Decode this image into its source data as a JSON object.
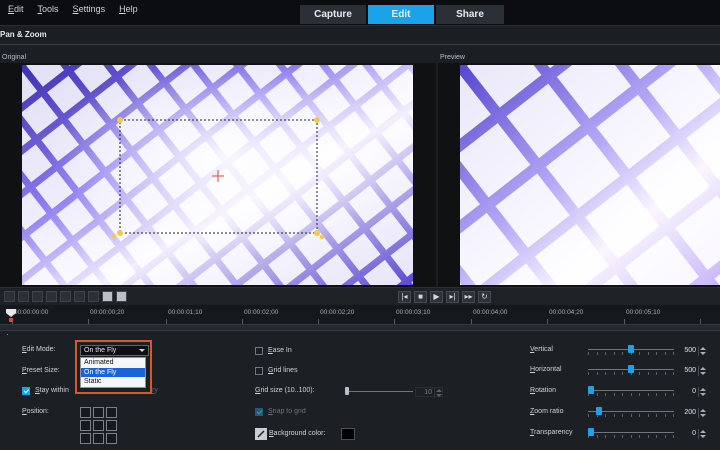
{
  "menu": [
    "Edit",
    "Tools",
    "Settings",
    "Help"
  ],
  "tabs": [
    {
      "label": "Capture",
      "active": false
    },
    {
      "label": "Edit",
      "active": true
    },
    {
      "label": "Share",
      "active": false
    }
  ],
  "panel_title": "Pan & Zoom",
  "original_label": "Original",
  "preview_label": "Preview",
  "timeline": {
    "timecodes": [
      "00:00:00:00",
      "00:00:00;20",
      "00:00:01;10",
      "00:00:02;00",
      "00:00:02;20",
      "00:00:03;10",
      "00:00:04;00",
      "00:00:04;20",
      "00:00:05;10"
    ]
  },
  "settings": {
    "edit_mode_label": "Edit Mode:",
    "edit_mode_value": "On the Fly",
    "edit_mode_options": [
      "Animated",
      "On the Fly",
      "Static"
    ],
    "preset_size_label": "Preset Size:",
    "stay_within_label": "Stay within",
    "stay_within_tail": "ounda",
    "stay_within_trail": "ry",
    "position_label": "Position:",
    "ease_in_label": "Ease In",
    "grid_lines_label": "Grid lines",
    "grid_size_label": "Grid size (10..100):",
    "grid_size_value": "10",
    "snap_to_grid_label": "Snap to grid",
    "background_color_label": "Background color:",
    "background_color": "#000000",
    "vertical_label": "Vertical",
    "vertical_value": "500",
    "horizontal_label": "Horizontal",
    "horizontal_value": "500",
    "rotation_label": "Rotation",
    "rotation_value": "0",
    "zoom_ratio_label": "Zoom ratio",
    "zoom_ratio_value": "200",
    "transparency_label": "Transparency",
    "transparency_value": "0"
  },
  "colors": {
    "accent": "#1aa3e8",
    "highlight": "#d6582b",
    "tile_light": "#ffffff",
    "tile_purple": "#6a5ce0"
  },
  "icons": [
    "crosshair-icon",
    "play-icon",
    "stop-icon",
    "next-frame-icon",
    "prev-frame-icon",
    "end-icon",
    "repeat-icon",
    "pen-icon",
    "playhead-icon"
  ]
}
